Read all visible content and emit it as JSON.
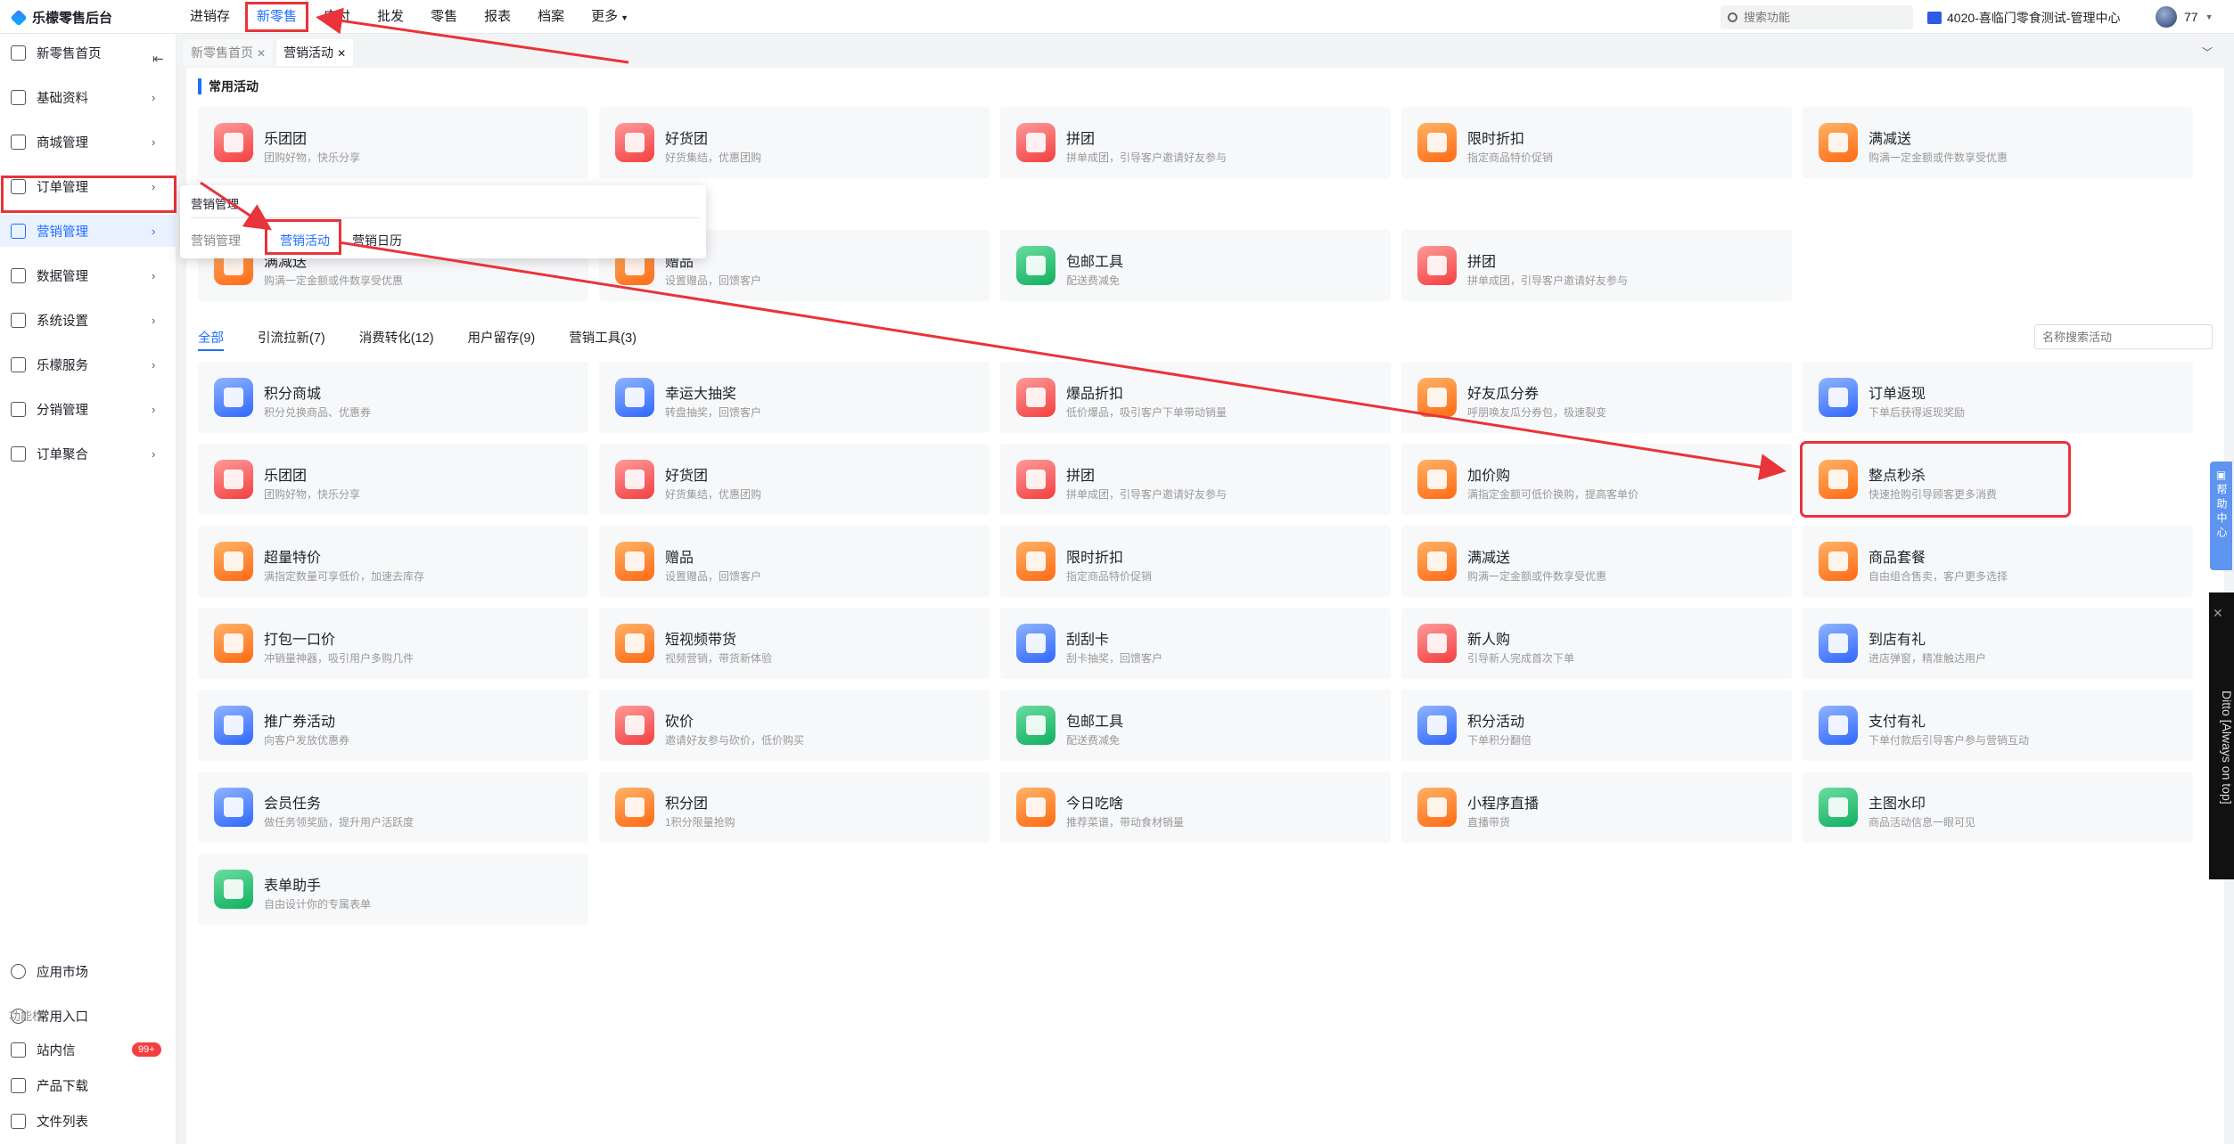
{
  "app_title": "乐檬零售后台",
  "top_nav": [
    {
      "label": "进销存",
      "active": false
    },
    {
      "label": "新零售",
      "active": true
    },
    {
      "label": "应付",
      "active": false
    },
    {
      "label": "批发",
      "active": false
    },
    {
      "label": "零售",
      "active": false
    },
    {
      "label": "报表",
      "active": false
    },
    {
      "label": "档案",
      "active": false
    },
    {
      "label": "更多",
      "active": false
    }
  ],
  "search": {
    "placeholder": "搜索功能"
  },
  "store_name": "4020-喜临门零食测试-管理中心",
  "user_name": "77",
  "sidebar": {
    "items": [
      {
        "label": "新零售首页"
      },
      {
        "label": "基础资料"
      },
      {
        "label": "商城管理"
      },
      {
        "label": "订单管理"
      },
      {
        "label": "营销管理"
      },
      {
        "label": "数据管理"
      },
      {
        "label": "系统设置"
      },
      {
        "label": "乐檬服务"
      },
      {
        "label": "分销管理"
      },
      {
        "label": "订单聚合"
      }
    ],
    "bottom_items": [
      {
        "label": "应用市场"
      },
      {
        "label": "常用入口"
      }
    ],
    "section_label": "功能栏",
    "tool_items": [
      {
        "label": "站内信",
        "badge": "99+"
      },
      {
        "label": "产品下载"
      },
      {
        "label": "文件列表"
      }
    ]
  },
  "page_tabs": [
    {
      "label": "新零售首页"
    },
    {
      "label": "营销活动"
    }
  ],
  "popup": {
    "title": "营销管理",
    "items": [
      "营销管理",
      "营销活动",
      "营销日历"
    ]
  },
  "common_section_title": "常用活动",
  "common_activities": [
    {
      "title": "乐团团",
      "desc": "团购好物，快乐分享",
      "icon": "group-buy-icon",
      "color": "r"
    },
    {
      "title": "好货团",
      "desc": "好货集结，优惠团购",
      "icon": "bag-icon",
      "color": "r"
    },
    {
      "title": "拼团",
      "desc": "拼单成团，引导客户邀请好友参与",
      "icon": "pin-group-icon",
      "color": "r"
    },
    {
      "title": "限时折扣",
      "desc": "指定商品特价促销",
      "icon": "alarm-clock-icon",
      "color": "o"
    },
    {
      "title": "满减送",
      "desc": "购满一定金额或件数享受优惠",
      "icon": "coupon-bag-icon",
      "color": "o"
    },
    {
      "title": "满减送",
      "desc": "购满一定金额或件数享受优惠",
      "icon": "coupon-bag-icon",
      "color": "o"
    },
    {
      "title": "赠品",
      "desc": "设置赠品，回馈客户",
      "icon": "gift-icon",
      "color": "o"
    },
    {
      "title": "包邮工具",
      "desc": "配送费减免",
      "icon": "truck-icon",
      "color": "g"
    },
    {
      "title": "拼团",
      "desc": "拼单成团，引导客户邀请好友参与",
      "icon": "pin-group-icon",
      "color": "r"
    }
  ],
  "filter_tabs": [
    "全部",
    "引流拉新(7)",
    "消费转化(12)",
    "用户留存(9)",
    "营销工具(3)"
  ],
  "activity_search": {
    "placeholder": "名称搜索活动"
  },
  "all_activities": [
    {
      "title": "积分商城",
      "desc": "积分兑换商品、优惠券",
      "icon": "points-store-icon",
      "color": "b"
    },
    {
      "title": "幸运大抽奖",
      "desc": "转盘抽奖，回馈客户",
      "icon": "lucky-wheel-icon",
      "color": "b"
    },
    {
      "title": "爆品折扣",
      "desc": "低价爆品，吸引客户下单带动销量",
      "icon": "hot-icon",
      "color": "r"
    },
    {
      "title": "好友瓜分券",
      "desc": "呼朋唤友瓜分券包，极速裂变",
      "icon": "split-coupon-icon",
      "color": "o"
    },
    {
      "title": "订单返现",
      "desc": "下单后获得返现奖励",
      "icon": "order-cashback-icon",
      "color": "b"
    },
    {
      "title": "乐团团",
      "desc": "团购好物，快乐分享",
      "icon": "group-buy-icon",
      "color": "r"
    },
    {
      "title": "好货团",
      "desc": "好货集结，优惠团购",
      "icon": "bag-icon",
      "color": "r"
    },
    {
      "title": "拼团",
      "desc": "拼单成团，引导客户邀请好友参与",
      "icon": "pin-group-icon",
      "color": "r"
    },
    {
      "title": "加价购",
      "desc": "满指定金额可低价换购，提高客单价",
      "icon": "add-price-icon",
      "color": "o"
    },
    {
      "title": "整点秒杀",
      "desc": "快速抢购引导顾客更多消费",
      "icon": "flash-sale-icon",
      "color": "o"
    },
    {
      "title": "超量特价",
      "desc": "满指定数量可享低价，加速去库存",
      "icon": "bulk-discount-icon",
      "color": "o"
    },
    {
      "title": "赠品",
      "desc": "设置赠品，回馈客户",
      "icon": "gift-icon",
      "color": "o"
    },
    {
      "title": "限时折扣",
      "desc": "指定商品特价促销",
      "icon": "alarm-clock-icon",
      "color": "o"
    },
    {
      "title": "满减送",
      "desc": "购满一定金额或件数享受优惠",
      "icon": "coupon-bag-icon",
      "color": "o"
    },
    {
      "title": "商品套餐",
      "desc": "自由组合售卖，客户更多选择",
      "icon": "package-icon",
      "color": "o"
    },
    {
      "title": "打包一口价",
      "desc": "冲销量神器，吸引用户多购几件",
      "icon": "box-price-icon",
      "color": "o"
    },
    {
      "title": "短视频带货",
      "desc": "视频营销，带货新体验",
      "icon": "video-icon",
      "color": "o"
    },
    {
      "title": "刮刮卡",
      "desc": "刮卡抽奖，回馈客户",
      "icon": "scratch-card-icon",
      "color": "b"
    },
    {
      "title": "新人购",
      "desc": "引导新人完成首次下单",
      "icon": "new-user-icon",
      "color": "r"
    },
    {
      "title": "到店有礼",
      "desc": "进店弹窗，精准触达用户",
      "icon": "store-gift-icon",
      "color": "b"
    },
    {
      "title": "推广券活动",
      "desc": "向客户发放优惠券",
      "icon": "promo-coupon-icon",
      "color": "b"
    },
    {
      "title": "砍价",
      "desc": "邀请好友参与砍价，低价购买",
      "icon": "bargain-icon",
      "color": "r"
    },
    {
      "title": "包邮工具",
      "desc": "配送费减免",
      "icon": "truck-icon",
      "color": "g"
    },
    {
      "title": "积分活动",
      "desc": "下单积分翻倍",
      "icon": "points-activity-icon",
      "color": "b"
    },
    {
      "title": "支付有礼",
      "desc": "下单付款后引导客户参与营销互动",
      "icon": "pay-gift-icon",
      "color": "b"
    },
    {
      "title": "会员任务",
      "desc": "做任务领奖励，提升用户活跃度",
      "icon": "member-task-icon",
      "color": "b"
    },
    {
      "title": "积分团",
      "desc": "1积分限量抢购",
      "icon": "points-group-icon",
      "color": "o"
    },
    {
      "title": "今日吃啥",
      "desc": "推荐菜谱，带动食材销量",
      "icon": "dish-icon",
      "color": "o"
    },
    {
      "title": "小程序直播",
      "desc": "直播带货",
      "icon": "live-icon",
      "color": "o"
    },
    {
      "title": "主图水印",
      "desc": "商品活动信息一眼可见",
      "icon": "watermark-icon",
      "color": "g"
    },
    {
      "title": "表单助手",
      "desc": "自由设计你的专属表单",
      "icon": "form-icon",
      "color": "g"
    }
  ],
  "help_text": "帮助中心",
  "ditto_text": "Ditto [Always on top]",
  "annotation_color": "#e8343a",
  "accent_color": "#1e6fff"
}
